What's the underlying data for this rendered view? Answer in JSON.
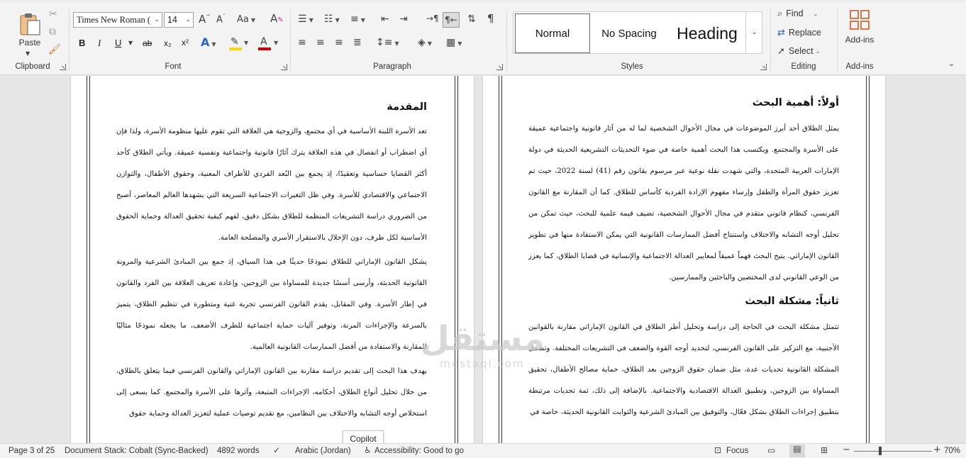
{
  "clipboard": {
    "paste_label": "Paste",
    "group_label": "Clipboard"
  },
  "font": {
    "name": "Times New Roman (",
    "size": "14",
    "group_label": "Font",
    "bold": "B",
    "italic": "I",
    "underline": "U",
    "strike": "ab",
    "subscript": "x₂",
    "superscript": "x²",
    "grow": "A^",
    "shrink": "Aˇ",
    "change_case": "Aa",
    "highlight_color": "#ffd700",
    "font_color": "#d00000"
  },
  "paragraph": {
    "group_label": "Paragraph"
  },
  "styles": {
    "group_label": "Styles",
    "items": [
      "Normal",
      "No Spacing",
      "Heading"
    ]
  },
  "editing": {
    "group_label": "Editing",
    "find": "Find",
    "replace": "Replace",
    "select": "Select"
  },
  "addins": {
    "button_label": "Add-ins",
    "group_label": "Add-ins"
  },
  "left_page": {
    "heading": "المقدمة",
    "paragraphs": [
      "تعد الأسرة اللبنة الأساسية في أي مجتمع، والزوجية هي العلاقة التي تقوم عليها منظومة الأسرة، ولذا فإن أي اضطراب أو انفصال في هذه العلاقة يترك آثارًا قانونية واجتماعية ونفسية عميقة. ويأتي الطلاق كأحد أكثر القضايا حساسية وتعقيدًا، إذ يجمع بين البُعد الفردي للأطراف المعنية، وحقوق الأطفال، والتوازن الاجتماعي والاقتصادي للأسرة. وفي ظل التغيرات الاجتماعية السريعة التي يشهدها العالم المعاصر، أصبح من الضروري دراسة التشريعات المنظمة للطلاق بشكل دقيق، لفهم كيفية تحقيق العدالة وحماية الحقوق الأساسية لكل طرف، دون الإخلال بالاستقرار الأسري والمصلحة العامة.",
      "يشكل القانون الإماراتي للطلاق نموذجًا حديثًا في هذا السياق، إذ جمع بين المبادئ الشرعية والمرونة القانونية الحديثة، وأرسى أسسًا جديدة للمساواة بين الزوجين، وإعادة تعريف العلاقة بين الفرد والقانون في إطار الأسرة. وفي المقابل، يقدم القانون الفرنسي تجربة غنية ومتطورة في تنظيم الطلاق، يتميز بالسرعة والإجراءات المرنة، وتوفير آليات حماية اجتماعية للطرف الأضعف، ما يجعله نموذجًا مثاليًا للمقارنة والاستفادة من أفضل الممارسات القانونية العالمية.",
      "يهدف هذا البحث إلى تقديم دراسة مقارنة بين القانون الإماراتي والقانون الفرنسي فيما يتعلق بالطلاق، من خلال تحليل أنواع الطلاق، أحكامه، الإجراءات المتبعة، وآثرها على الأسرة والمجتمع. كما يسعى إلى استخلاص أوجه التشابه والاختلاف بين النظامين، مع تقديم توصيات عملية لتعزيز العدالة وحماية حقوق"
    ]
  },
  "right_page": {
    "heading1": "أولاً: أهمية البحث",
    "paragraph1": "يمثل الطلاق أحد أبرز الموضوعات في مجال الأحوال الشخصية لما له من آثار قانونية واجتماعية عميقة على الأسرة والمجتمع. ويكتسب هذا البحث أهمية خاصة في ضوء التحديثات التشريعية الحديثة في دولة الإمارات العربية المتحدة، والتي شهدت نقلة نوعية عبر مرسوم بقانون رقم (41) لسنة 2022، حيث تم تعزيز حقوق المرأة والطفل وإرساء مفهوم الإرادة الفردية كأساس للطلاق. كما أن المقارنة مع القانون الفرنسي، كنظام قانوني متقدم في مجال الأحوال الشخصية، تضيف قيمة علمية للبحث، حيث تمكن من تحليل أوجه التشابه والاختلاف واستنتاج أفضل الممارسات القانونية التي يمكن الاستفادة منها في تطوير القانون الإماراتي. يتيح البحث فهماً عميقاً لمعايير العدالة الاجتماعية والإنسانية في قضايا الطلاق، كما يعزز من الوعي القانوني لدى المختصين والباحثين والممارسين.",
    "heading2": "ثانياً: مشكلة البحث",
    "paragraph2": "تتمثل مشكلة البحث في الحاجة إلى دراسة وتحليل أطر الطلاق في القانون الإماراتي مقارنة بالقوانين الأجنبية، مع التركيز على القانون الفرنسي، لتحديد أوجه القوة والضعف في التشريعات المختلفة. وتشمل المشكلة القانونية تحديات عدة، مثل ضمان حقوق الزوجين بعد الطلاق، حماية مصالح الأطفال، تحقيق المساواة بين الزوجين، وتطبيق العدالة الاقتصادية والاجتماعية. بالإضافة إلى ذلك، ثمة تحديات مرتبطة بتطبيق إجراءات الطلاق بشكل فعّال، والتوفيق بين المبادئ الشرعية والثوابت القانونية الحديثة، خاصة في"
  },
  "watermark": {
    "arabic": "مستقل",
    "latin": "mostaql.com"
  },
  "tooltip": "Copilot",
  "status": {
    "page": "Page 3 of 25",
    "doc_stack": "Document Stack: Cobalt (Sync-Backed)",
    "words": "4892 words",
    "language": "Arabic (Jordan)",
    "accessibility": "Accessibility: Good to go",
    "focus": "Focus",
    "zoom": "70%",
    "zoom_fraction": 0.7
  }
}
